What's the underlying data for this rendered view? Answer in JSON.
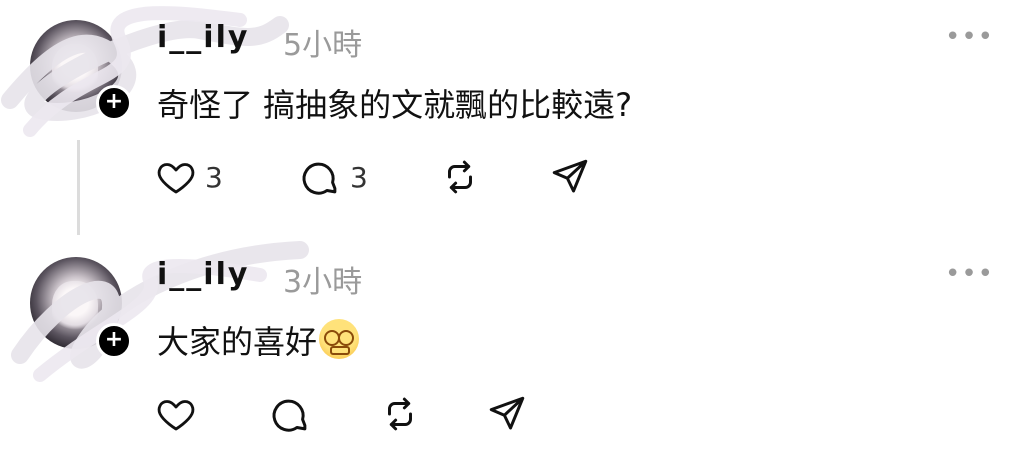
{
  "posts": [
    {
      "username": "i__ily",
      "time": "5小時",
      "text": "奇怪了 搞抽象的文就飄的比較遠?",
      "more": "•••",
      "badge": "+",
      "like_count": "3",
      "reply_count": "3"
    },
    {
      "username": "i__ily",
      "time": "3小時",
      "text": "大家的喜好",
      "more": "•••",
      "badge": "+",
      "emoji": "dizzy-face-emoji"
    }
  ],
  "icons": {
    "like": "heart-icon",
    "reply": "comment-icon",
    "repost": "repost-icon",
    "share": "send-icon"
  },
  "colors": {
    "text": "#111111",
    "muted": "#9a9a9a",
    "thread_line": "#dcdcdc"
  }
}
